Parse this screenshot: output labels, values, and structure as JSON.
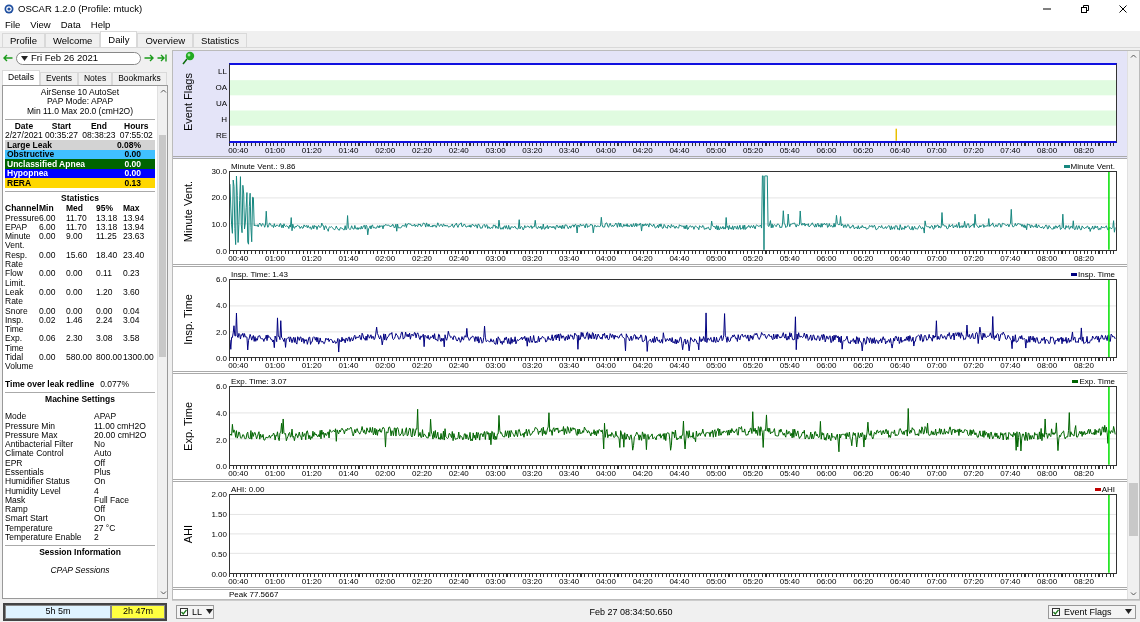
{
  "window": {
    "title": "OSCAR 1.2.0 (Profile: mtuck)"
  },
  "menu": [
    "File",
    "View",
    "Data",
    "Help"
  ],
  "tabs": [
    {
      "label": "Profile",
      "selected": false
    },
    {
      "label": "Welcome",
      "selected": false
    },
    {
      "label": "Daily",
      "selected": true
    },
    {
      "label": "Overview",
      "selected": false
    },
    {
      "label": "Statistics",
      "selected": false
    }
  ],
  "date_nav": {
    "date": "Fri Feb 26 2021"
  },
  "subtabs": [
    {
      "label": "Details",
      "selected": true
    },
    {
      "label": "Events",
      "selected": false
    },
    {
      "label": "Notes",
      "selected": false
    },
    {
      "label": "Bookmarks",
      "selected": false
    }
  ],
  "details": {
    "device": "AirSense 10 AutoSet",
    "mode": "PAP Mode: APAP",
    "pressure": "Min 11.0 Max 20.0 (cmH2O)",
    "session_columns": [
      "Date",
      "Start",
      "End",
      "Hours"
    ],
    "session_values": [
      "2/27/2021",
      "00:35:27",
      "08:38:23",
      "07:55:02"
    ],
    "indices": [
      {
        "name": "Large Leak",
        "value": "0.08%",
        "color": "#d3d3d3"
      },
      {
        "name": "Obstructive",
        "value": "0.00",
        "color": "#40c0ff"
      },
      {
        "name": "Unclassified Apnea",
        "value": "0.00",
        "color": "#006400"
      },
      {
        "name": "Hypopnea",
        "value": "0.00",
        "color": "#0000ff"
      },
      {
        "name": "RERA",
        "value": "0.13",
        "color": "#ffd700"
      }
    ],
    "statistics": {
      "title": "Statistics",
      "columns": [
        "Channel",
        "Min",
        "Med",
        "95%",
        "Max"
      ],
      "rows": [
        [
          "Pressure",
          "6.00",
          "11.70",
          "13.18",
          "13.94"
        ],
        [
          "EPAP",
          "6.00",
          "11.70",
          "13.18",
          "13.94"
        ],
        [
          "Minute Vent.",
          "0.00",
          "9.00",
          "11.25",
          "23.63"
        ],
        [
          "Resp. Rate",
          "0.00",
          "15.60",
          "18.40",
          "23.40"
        ],
        [
          "Flow Limit.",
          "0.00",
          "0.00",
          "0.11",
          "0.23"
        ],
        [
          "Leak Rate",
          "0.00",
          "0.00",
          "1.20",
          "3.60"
        ],
        [
          "Snore",
          "0.00",
          "0.00",
          "0.00",
          "0.04"
        ],
        [
          "Insp. Time",
          "0.02",
          "1.46",
          "2.24",
          "3.04"
        ],
        [
          "Exp. Time",
          "0.06",
          "2.30",
          "3.08",
          "3.58"
        ],
        [
          "Tidal Volume",
          "0.00",
          "580.00",
          "800.00",
          "1300.00"
        ]
      ]
    },
    "leak_redline": {
      "label": "Time over leak redline",
      "value": "0.077%"
    },
    "machine_settings": {
      "title": "Machine Settings",
      "rows": [
        {
          "name": "Mode",
          "value": "APAP"
        },
        {
          "name": "Pressure Min",
          "value": "11.00 cmH2O"
        },
        {
          "name": "Pressure Max",
          "value": "20.00 cmH2O"
        },
        {
          "name": "Antibacterial Filter",
          "value": "No"
        },
        {
          "name": "Climate Control",
          "value": "Auto"
        },
        {
          "name": "EPR",
          "value": "Off"
        },
        {
          "name": "Essentials",
          "value": "Plus"
        },
        {
          "name": "Humidifier Status",
          "value": "On"
        },
        {
          "name": "Humidity Level",
          "value": "4"
        },
        {
          "name": "Mask",
          "value": "Full Face"
        },
        {
          "name": "Ramp",
          "value": "Off"
        },
        {
          "name": "Smart Start",
          "value": "On"
        },
        {
          "name": "Temperature",
          "value": "27 °C"
        },
        {
          "name": "Temperature Enable",
          "value": "2"
        }
      ]
    },
    "session_info": {
      "title": "Session Information",
      "subtitle": "CPAP Sessions"
    }
  },
  "time_bars": [
    {
      "label": "5h 5m",
      "color": "#dff3ff"
    },
    {
      "label": "2h 47m",
      "color": "#ffff40"
    }
  ],
  "graphs": [
    {
      "kind": "flags",
      "title": "Event Flags",
      "rows": [
        "LL",
        "OA",
        "UA",
        "H",
        "RE"
      ],
      "xticks": [
        "00:40",
        "01:00",
        "01:20",
        "01:40",
        "02:00",
        "02:20",
        "02:40",
        "03:00",
        "03:20",
        "03:40",
        "04:00",
        "04:20",
        "04:40",
        "05:00",
        "05:20",
        "05:40",
        "06:00",
        "06:20",
        "06:40",
        "07:00",
        "07:20",
        "07:40",
        "08:00",
        "08:20"
      ]
    },
    {
      "kind": "wave",
      "title": "Minute Vent.",
      "readout": "Minute Vent.: 9.86",
      "legend": "Minute Vent.",
      "color": "#17877f",
      "yticks": [
        "30.0",
        "20.0",
        "10.0",
        "0.0"
      ],
      "xticks": [
        "00:40",
        "01:00",
        "01:20",
        "01:40",
        "02:00",
        "02:20",
        "02:40",
        "03:00",
        "03:20",
        "03:40",
        "04:00",
        "04:20",
        "04:40",
        "05:00",
        "05:20",
        "05:40",
        "06:00",
        "06:20",
        "06:40",
        "07:00",
        "07:20",
        "07:40",
        "08:00",
        "08:20"
      ]
    },
    {
      "kind": "wave",
      "title": "Insp. Time",
      "readout": "Insp. Time: 1.43",
      "legend": "Insp. Time",
      "color": "#000080",
      "yticks": [
        "6.0",
        "4.0",
        "2.0",
        "0.0"
      ],
      "xticks": [
        "00:40",
        "01:00",
        "01:20",
        "01:40",
        "02:00",
        "02:20",
        "02:40",
        "03:00",
        "03:20",
        "03:40",
        "04:00",
        "04:20",
        "04:40",
        "05:00",
        "05:20",
        "05:40",
        "06:00",
        "06:20",
        "06:40",
        "07:00",
        "07:20",
        "07:40",
        "08:00",
        "08:20"
      ]
    },
    {
      "kind": "wave",
      "title": "Exp. Time",
      "readout": "Exp. Time: 3.07",
      "legend": "Exp. Time",
      "color": "#006400",
      "yticks": [
        "6.0",
        "4.0",
        "2.0",
        "0.0"
      ],
      "xticks": [
        "00:40",
        "01:00",
        "01:20",
        "01:40",
        "02:00",
        "02:20",
        "02:40",
        "03:00",
        "03:20",
        "03:40",
        "04:00",
        "04:20",
        "04:40",
        "05:00",
        "05:20",
        "05:40",
        "06:00",
        "06:20",
        "06:40",
        "07:00",
        "07:20",
        "07:40",
        "08:00",
        "08:20"
      ]
    },
    {
      "kind": "empty",
      "title": "AHI",
      "readout": "AHI: 0.00",
      "legend": "AHI",
      "color": "#c00000",
      "yticks": [
        "2.00",
        "1.50",
        "1.00",
        "0.50",
        "0.00"
      ],
      "xticks": [
        "00:40",
        "01:00",
        "01:20",
        "01:40",
        "02:00",
        "02:20",
        "02:40",
        "03:00",
        "03:20",
        "03:40",
        "04:00",
        "04:20",
        "04:40",
        "05:00",
        "05:20",
        "05:40",
        "06:00",
        "06:20",
        "06:40",
        "07:00",
        "07:20",
        "07:40",
        "08:00",
        "08:20"
      ]
    }
  ],
  "peak_readout": "Peak 77.5667",
  "status_bar": {
    "left": {
      "label": "LL",
      "checked": true
    },
    "time": "Feb 27 08:34:50.650",
    "right": {
      "label": "Event Flags",
      "checked": true
    }
  }
}
